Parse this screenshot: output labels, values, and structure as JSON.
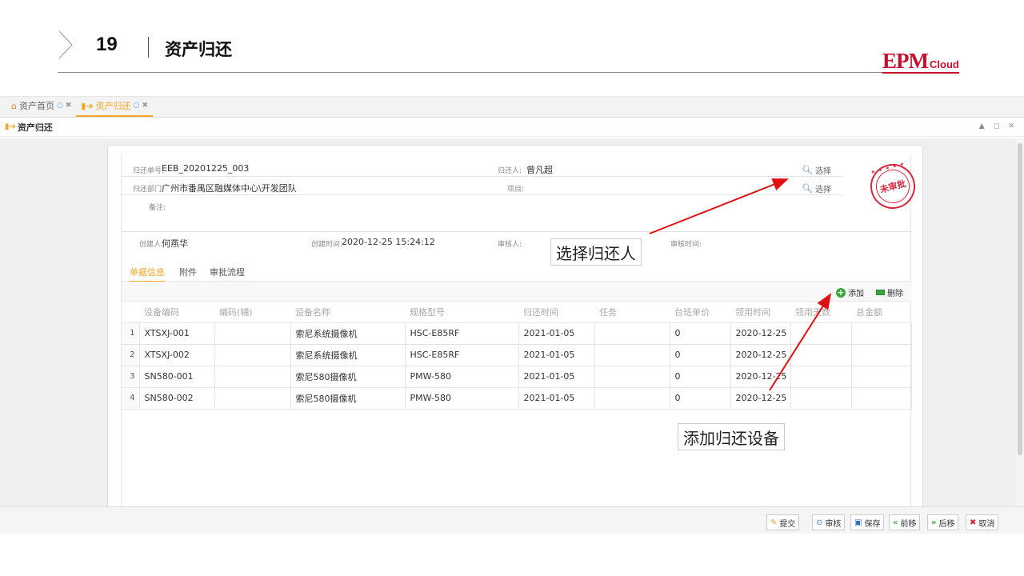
{
  "header": {
    "number": "19",
    "title": "资产归还",
    "logo_main": "EPM",
    "logo_sub": "Cloud"
  },
  "tabs": [
    {
      "label": "资产首页",
      "icon": "home-icon"
    },
    {
      "label": "资产归还",
      "icon": "return-icon"
    }
  ],
  "panel": {
    "title": "资产归还",
    "controls": "▲ ◻ ✕"
  },
  "form": {
    "return_no_label": "归还单号:",
    "return_no": "EEB_20201225_003",
    "returner_label": "归还人:",
    "returner": "曾凡超",
    "select_label": "选择",
    "dept_label": "归还部门:",
    "dept": "广州市番禺区融媒体中心\\开发团队",
    "project_label": "项目:",
    "project": "",
    "remark_label": "备注:",
    "remark": "",
    "creator_label": "创建人:",
    "creator": "何燕华",
    "created_time_label": "创建时间:",
    "created_time": "2020-12-25 15:24:12",
    "reviewer_label": "审核人:",
    "reviewer": "",
    "review_time_label": "审核时间:",
    "review_time": ""
  },
  "stamp": {
    "text": "未审批",
    "stars": "★ ★ ★ ★ ★"
  },
  "subtabs": [
    "单据信息",
    "附件",
    "审批流程"
  ],
  "toolbar": {
    "add": "添加",
    "delete": "删除"
  },
  "table": {
    "headers": [
      "设备编码",
      "编码(辅)",
      "设备名称",
      "规格型号",
      "归还时间",
      "任务",
      "台班单价",
      "领用时间",
      "领用天数",
      "总金额"
    ],
    "rows": [
      {
        "n": "1",
        "code": "XTSXJ-001",
        "aux": "",
        "name": "索尼系统摄像机",
        "model": "HSC-E85RF",
        "return_time": "2021-01-05",
        "task": "",
        "price": "0",
        "use_time": "2020-12-25",
        "days": "",
        "total": ""
      },
      {
        "n": "2",
        "code": "XTSXJ-002",
        "aux": "",
        "name": "索尼系统摄像机",
        "model": "HSC-E85RF",
        "return_time": "2021-01-05",
        "task": "",
        "price": "0",
        "use_time": "2020-12-25",
        "days": "",
        "total": ""
      },
      {
        "n": "3",
        "code": "SN580-001",
        "aux": "",
        "name": "索尼580摄像机",
        "model": "PMW-580",
        "return_time": "2021-01-05",
        "task": "",
        "price": "0",
        "use_time": "2020-12-25",
        "days": "",
        "total": ""
      },
      {
        "n": "4",
        "code": "SN580-002",
        "aux": "",
        "name": "索尼580摄像机",
        "model": "PMW-580",
        "return_time": "2021-01-05",
        "task": "",
        "price": "0",
        "use_time": "2020-12-25",
        "days": "",
        "total": ""
      }
    ]
  },
  "footer": {
    "submit": "提交",
    "review": "审核",
    "save": "保存",
    "prev": "前移",
    "next": "后移",
    "cancel": "取消"
  },
  "annotations": {
    "select_returner": "选择归还人",
    "add_device": "添加归还设备"
  },
  "colors": {
    "accent": "#f5a623",
    "stamp": "#d7263d",
    "arrow": "#e01010",
    "logo": "#c8102e"
  }
}
